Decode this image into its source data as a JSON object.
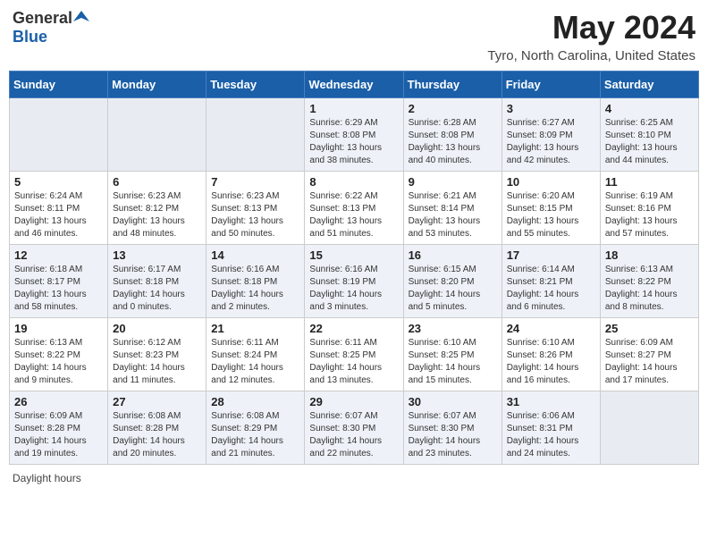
{
  "header": {
    "logo_general": "General",
    "logo_blue": "Blue",
    "title": "May 2024",
    "subtitle": "Tyro, North Carolina, United States"
  },
  "days_of_week": [
    "Sunday",
    "Monday",
    "Tuesday",
    "Wednesday",
    "Thursday",
    "Friday",
    "Saturday"
  ],
  "weeks": [
    [
      {
        "day": "",
        "empty": true
      },
      {
        "day": "",
        "empty": true
      },
      {
        "day": "",
        "empty": true
      },
      {
        "day": "1",
        "sunrise": "Sunrise: 6:29 AM",
        "sunset": "Sunset: 8:08 PM",
        "daylight": "Daylight: 13 hours and 38 minutes."
      },
      {
        "day": "2",
        "sunrise": "Sunrise: 6:28 AM",
        "sunset": "Sunset: 8:08 PM",
        "daylight": "Daylight: 13 hours and 40 minutes."
      },
      {
        "day": "3",
        "sunrise": "Sunrise: 6:27 AM",
        "sunset": "Sunset: 8:09 PM",
        "daylight": "Daylight: 13 hours and 42 minutes."
      },
      {
        "day": "4",
        "sunrise": "Sunrise: 6:25 AM",
        "sunset": "Sunset: 8:10 PM",
        "daylight": "Daylight: 13 hours and 44 minutes."
      }
    ],
    [
      {
        "day": "5",
        "sunrise": "Sunrise: 6:24 AM",
        "sunset": "Sunset: 8:11 PM",
        "daylight": "Daylight: 13 hours and 46 minutes."
      },
      {
        "day": "6",
        "sunrise": "Sunrise: 6:23 AM",
        "sunset": "Sunset: 8:12 PM",
        "daylight": "Daylight: 13 hours and 48 minutes."
      },
      {
        "day": "7",
        "sunrise": "Sunrise: 6:23 AM",
        "sunset": "Sunset: 8:13 PM",
        "daylight": "Daylight: 13 hours and 50 minutes."
      },
      {
        "day": "8",
        "sunrise": "Sunrise: 6:22 AM",
        "sunset": "Sunset: 8:13 PM",
        "daylight": "Daylight: 13 hours and 51 minutes."
      },
      {
        "day": "9",
        "sunrise": "Sunrise: 6:21 AM",
        "sunset": "Sunset: 8:14 PM",
        "daylight": "Daylight: 13 hours and 53 minutes."
      },
      {
        "day": "10",
        "sunrise": "Sunrise: 6:20 AM",
        "sunset": "Sunset: 8:15 PM",
        "daylight": "Daylight: 13 hours and 55 minutes."
      },
      {
        "day": "11",
        "sunrise": "Sunrise: 6:19 AM",
        "sunset": "Sunset: 8:16 PM",
        "daylight": "Daylight: 13 hours and 57 minutes."
      }
    ],
    [
      {
        "day": "12",
        "sunrise": "Sunrise: 6:18 AM",
        "sunset": "Sunset: 8:17 PM",
        "daylight": "Daylight: 13 hours and 58 minutes."
      },
      {
        "day": "13",
        "sunrise": "Sunrise: 6:17 AM",
        "sunset": "Sunset: 8:18 PM",
        "daylight": "Daylight: 14 hours and 0 minutes."
      },
      {
        "day": "14",
        "sunrise": "Sunrise: 6:16 AM",
        "sunset": "Sunset: 8:18 PM",
        "daylight": "Daylight: 14 hours and 2 minutes."
      },
      {
        "day": "15",
        "sunrise": "Sunrise: 6:16 AM",
        "sunset": "Sunset: 8:19 PM",
        "daylight": "Daylight: 14 hours and 3 minutes."
      },
      {
        "day": "16",
        "sunrise": "Sunrise: 6:15 AM",
        "sunset": "Sunset: 8:20 PM",
        "daylight": "Daylight: 14 hours and 5 minutes."
      },
      {
        "day": "17",
        "sunrise": "Sunrise: 6:14 AM",
        "sunset": "Sunset: 8:21 PM",
        "daylight": "Daylight: 14 hours and 6 minutes."
      },
      {
        "day": "18",
        "sunrise": "Sunrise: 6:13 AM",
        "sunset": "Sunset: 8:22 PM",
        "daylight": "Daylight: 14 hours and 8 minutes."
      }
    ],
    [
      {
        "day": "19",
        "sunrise": "Sunrise: 6:13 AM",
        "sunset": "Sunset: 8:22 PM",
        "daylight": "Daylight: 14 hours and 9 minutes."
      },
      {
        "day": "20",
        "sunrise": "Sunrise: 6:12 AM",
        "sunset": "Sunset: 8:23 PM",
        "daylight": "Daylight: 14 hours and 11 minutes."
      },
      {
        "day": "21",
        "sunrise": "Sunrise: 6:11 AM",
        "sunset": "Sunset: 8:24 PM",
        "daylight": "Daylight: 14 hours and 12 minutes."
      },
      {
        "day": "22",
        "sunrise": "Sunrise: 6:11 AM",
        "sunset": "Sunset: 8:25 PM",
        "daylight": "Daylight: 14 hours and 13 minutes."
      },
      {
        "day": "23",
        "sunrise": "Sunrise: 6:10 AM",
        "sunset": "Sunset: 8:25 PM",
        "daylight": "Daylight: 14 hours and 15 minutes."
      },
      {
        "day": "24",
        "sunrise": "Sunrise: 6:10 AM",
        "sunset": "Sunset: 8:26 PM",
        "daylight": "Daylight: 14 hours and 16 minutes."
      },
      {
        "day": "25",
        "sunrise": "Sunrise: 6:09 AM",
        "sunset": "Sunset: 8:27 PM",
        "daylight": "Daylight: 14 hours and 17 minutes."
      }
    ],
    [
      {
        "day": "26",
        "sunrise": "Sunrise: 6:09 AM",
        "sunset": "Sunset: 8:28 PM",
        "daylight": "Daylight: 14 hours and 19 minutes."
      },
      {
        "day": "27",
        "sunrise": "Sunrise: 6:08 AM",
        "sunset": "Sunset: 8:28 PM",
        "daylight": "Daylight: 14 hours and 20 minutes."
      },
      {
        "day": "28",
        "sunrise": "Sunrise: 6:08 AM",
        "sunset": "Sunset: 8:29 PM",
        "daylight": "Daylight: 14 hours and 21 minutes."
      },
      {
        "day": "29",
        "sunrise": "Sunrise: 6:07 AM",
        "sunset": "Sunset: 8:30 PM",
        "daylight": "Daylight: 14 hours and 22 minutes."
      },
      {
        "day": "30",
        "sunrise": "Sunrise: 6:07 AM",
        "sunset": "Sunset: 8:30 PM",
        "daylight": "Daylight: 14 hours and 23 minutes."
      },
      {
        "day": "31",
        "sunrise": "Sunrise: 6:06 AM",
        "sunset": "Sunset: 8:31 PM",
        "daylight": "Daylight: 14 hours and 24 minutes."
      },
      {
        "day": "",
        "empty": true
      }
    ]
  ],
  "footer": {
    "daylight_label": "Daylight hours"
  }
}
